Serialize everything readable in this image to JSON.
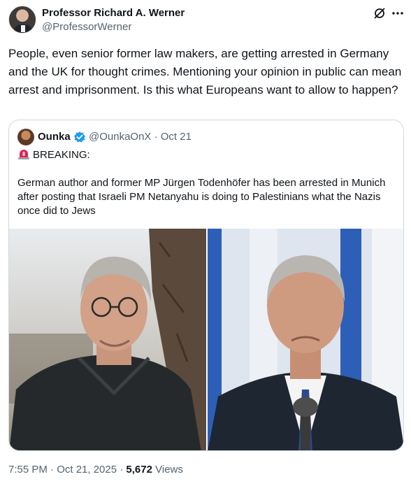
{
  "author": {
    "name": "Professor Richard A. Werner",
    "handle": "@ProfessorWerner"
  },
  "tweet": {
    "text": "People, even senior former law makers, are getting arrested in Germany and the UK for thought crimes. Mentioning your opinion in public can mean arrest and imprisonment. Is this what Europeans want to allow to happen?"
  },
  "quoted": {
    "name": "Ounka",
    "handle_date": "@OunkaOnX · Oct 21",
    "headline": "BREAKING:",
    "body": "German author and former MP Jürgen Todenhöfer has been arrested in Munich after posting that Israeli PM Netanyahu is doing to Palestinians what the Nazis once did to Jews",
    "icons": {
      "verified": "verified-badge-icon",
      "alert": "rotating-light-icon"
    }
  },
  "footer": {
    "time_date": "7:55 PM · Oct 21, 2025 · ",
    "views_count": "5,672",
    "views_label": " Views"
  },
  "colors": {
    "text": "#0f1419",
    "secondary": "#536471",
    "border": "#cfd9de",
    "verified": "#1d9bf0"
  }
}
